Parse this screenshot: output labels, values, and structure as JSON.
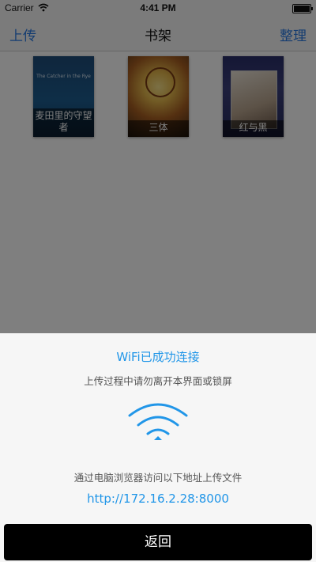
{
  "status_bar": {
    "carrier": "Carrier",
    "time": "4:41 PM"
  },
  "nav": {
    "left": "上传",
    "title": "书架",
    "right": "整理"
  },
  "books": [
    {
      "title": "麦田里的守望者",
      "subtitle": "The Catcher in the Rye"
    },
    {
      "title": "三体"
    },
    {
      "title": "红与黑"
    }
  ],
  "sheet": {
    "title": "WiFi已成功连接",
    "warning": "上传过程中请勿离开本界面或锁屏",
    "icon": "wifi-icon",
    "instruction": "通过电脑浏览器访问以下地址上传文件",
    "url": "http://172.16.2.28:8000",
    "back_label": "返回"
  },
  "colors": {
    "accent": "#2196e8",
    "nav_link": "#2a7ae2",
    "button_bg": "#000000"
  }
}
